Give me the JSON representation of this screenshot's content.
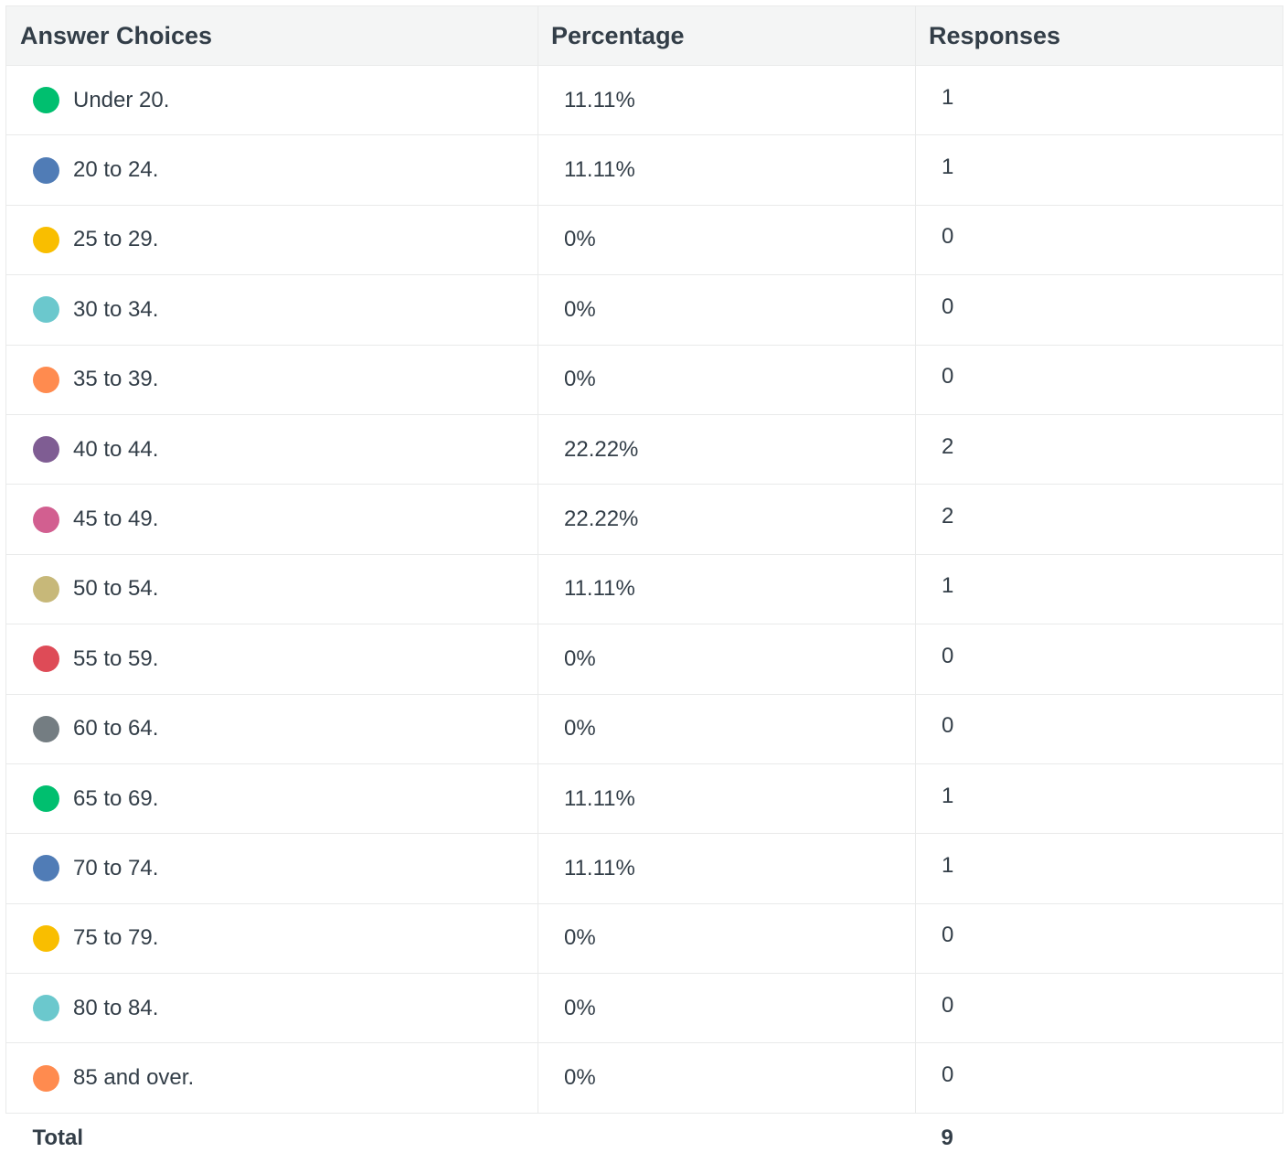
{
  "chart_data": {
    "type": "table",
    "columns": [
      "Answer Choices",
      "Percentage",
      "Responses"
    ],
    "rows": [
      {
        "label": "Under 20.",
        "percentage": "11.11%",
        "responses": "1",
        "color": "#00bf6f"
      },
      {
        "label": "20 to 24.",
        "percentage": "11.11%",
        "responses": "1",
        "color": "#507cb6"
      },
      {
        "label": "25 to 29.",
        "percentage": "0%",
        "responses": "0",
        "color": "#f9be00"
      },
      {
        "label": "30 to 34.",
        "percentage": "0%",
        "responses": "0",
        "color": "#6bc8cd"
      },
      {
        "label": "35 to 39.",
        "percentage": "0%",
        "responses": "0",
        "color": "#ff8b4f"
      },
      {
        "label": "40 to 44.",
        "percentage": "22.22%",
        "responses": "2",
        "color": "#7f5d93"
      },
      {
        "label": "45 to 49.",
        "percentage": "22.22%",
        "responses": "2",
        "color": "#d25f90"
      },
      {
        "label": "50 to 54.",
        "percentage": "11.11%",
        "responses": "1",
        "color": "#c7b879"
      },
      {
        "label": "55 to 59.",
        "percentage": "0%",
        "responses": "0",
        "color": "#de4b57"
      },
      {
        "label": "60 to 64.",
        "percentage": "0%",
        "responses": "0",
        "color": "#747d82"
      },
      {
        "label": "65 to 69.",
        "percentage": "11.11%",
        "responses": "1",
        "color": "#00bf6f"
      },
      {
        "label": "70 to 74.",
        "percentage": "11.11%",
        "responses": "1",
        "color": "#507cb6"
      },
      {
        "label": "75 to 79.",
        "percentage": "0%",
        "responses": "0",
        "color": "#f9be00"
      },
      {
        "label": "80 to 84.",
        "percentage": "0%",
        "responses": "0",
        "color": "#6bc8cd"
      },
      {
        "label": "85 and over.",
        "percentage": "0%",
        "responses": "0",
        "color": "#ff8b4f"
      }
    ],
    "total": {
      "label": "Total",
      "value": "9"
    }
  }
}
